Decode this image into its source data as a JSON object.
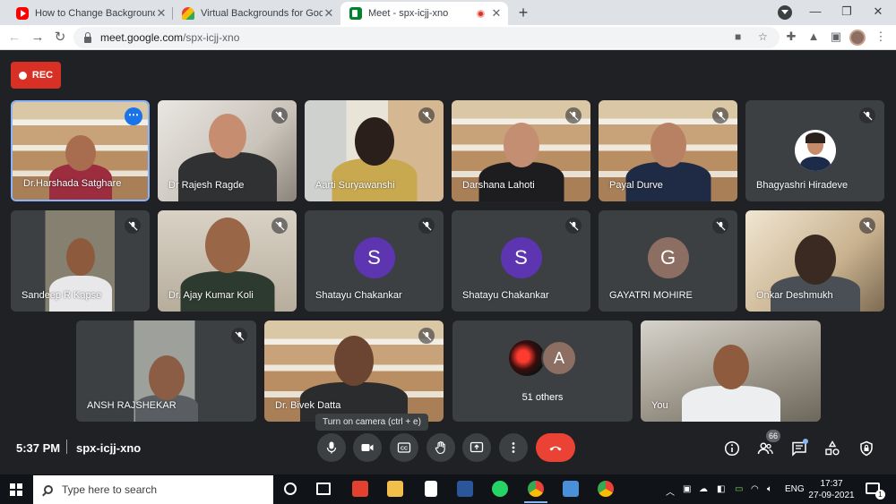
{
  "browser": {
    "tabs": [
      {
        "title": "How to Change Background in G"
      },
      {
        "title": "Virtual Backgrounds for Google M"
      },
      {
        "title": "Meet - spx-icjj-xno"
      }
    ],
    "url_domain": "meet.google.com",
    "url_path": "/spx-icjj-xno"
  },
  "meet": {
    "rec_label": "REC",
    "participants": [
      {
        "name": "Dr.Harshada Satghare"
      },
      {
        "name": "Dr Rajesh Ragde"
      },
      {
        "name": "Aarti Suryawanshi"
      },
      {
        "name": "Darshana Lahoti"
      },
      {
        "name": "Payal Durve"
      },
      {
        "name": "Bhagyashri Hiradeve"
      },
      {
        "name": "Sandeep R Kapse"
      },
      {
        "name": "Dr. Ajay Kumar Koli"
      },
      {
        "name": "Shatayu Chakankar",
        "initial": "S",
        "color": "#5e35b1"
      },
      {
        "name": "Shatayu Chakankar",
        "initial": "S",
        "color": "#5e35b1"
      },
      {
        "name": "GAYATRI MOHIRE",
        "initial": "G",
        "color": "#8d6e63"
      },
      {
        "name": "Onkar Deshmukh"
      },
      {
        "name": "ANSH RAJSHEKAR"
      },
      {
        "name": "Dr. Bivek Datta"
      },
      {
        "name": "You"
      }
    ],
    "others": {
      "label": "51 others",
      "initial": "A",
      "color": "#8d6e63"
    },
    "tooltip": "Turn on camera (ctrl + e)",
    "time": "5:37 PM",
    "meeting_code": "spx-icjj-xno",
    "people_count": "66"
  },
  "taskbar": {
    "search_placeholder": "Type here to search",
    "language": "ENG",
    "time": "17:37",
    "date": "27-09-2021",
    "notification_count": "1"
  }
}
